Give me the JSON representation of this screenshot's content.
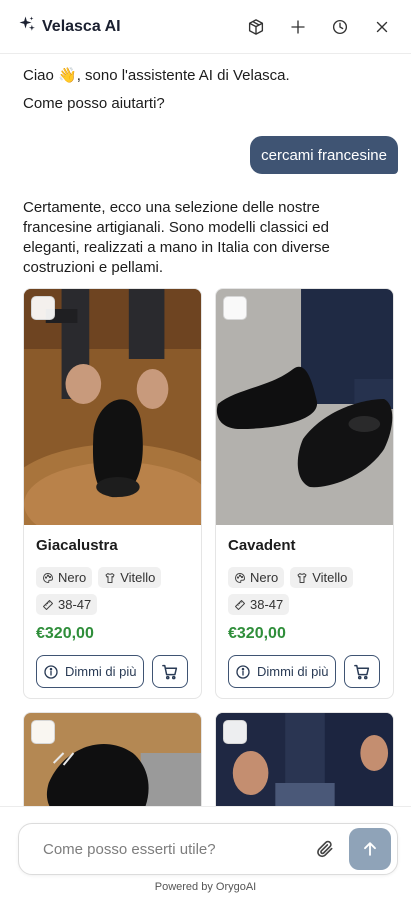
{
  "header": {
    "title": "Velasca AI",
    "icons": [
      "sparkle-icon",
      "cube-icon",
      "plus-icon",
      "history-icon",
      "close-icon"
    ]
  },
  "messages": {
    "greeting_line1": "Ciao 👋, sono l'assistente AI di Velasca.",
    "greeting_line2": "Come posso aiutarti?",
    "user_query": "cercami francesine",
    "assistant_reply": "Certamente, ecco una selezione delle nostre francesine artigianali. Sono modelli classici ed eleganti, realizzati a mano in Italia con diverse costruzioni e pellami."
  },
  "products": [
    {
      "name": "Giacalustra",
      "color": "Nero",
      "material": "Vitello",
      "sizes": "38-47",
      "price": "€320,00",
      "more_label": "Dimmi di più"
    },
    {
      "name": "Cavadent",
      "color": "Nero",
      "material": "Vitello",
      "sizes": "38-47",
      "price": "€320,00",
      "more_label": "Dimmi di più"
    }
  ],
  "composer": {
    "placeholder": "Come posso esserti utile?",
    "powered_by": "Powered by OrygoAI"
  },
  "colors": {
    "accent": "#3f5473",
    "price": "#2f8e3a",
    "send_button": "#8fa3b8"
  }
}
